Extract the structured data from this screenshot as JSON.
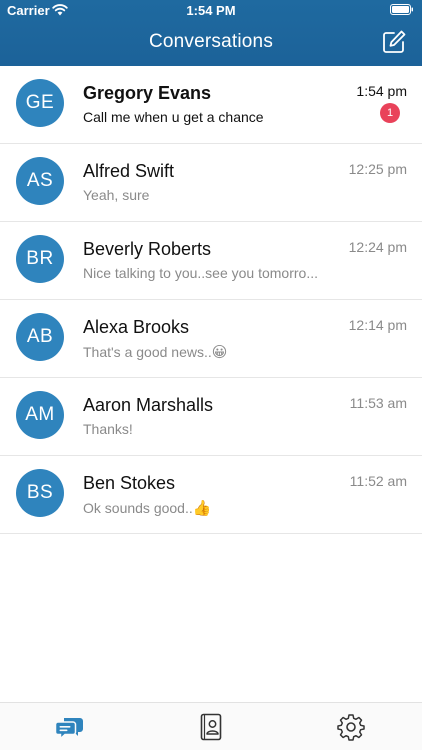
{
  "status": {
    "carrier": "Carrier",
    "time": "1:54 PM"
  },
  "nav": {
    "title": "Conversations"
  },
  "colors": {
    "header": "#1f6aa0",
    "avatar": "#2f84bd",
    "badge": "#e9425a",
    "active_tab": "#2f84bd"
  },
  "conversations": [
    {
      "initials": "GE",
      "name": "Gregory Evans",
      "preview": "Call me when u get a chance",
      "time": "1:54 pm",
      "unread": "1"
    },
    {
      "initials": "AS",
      "name": "Alfred Swift",
      "preview": "Yeah, sure",
      "time": "12:25 pm"
    },
    {
      "initials": "BR",
      "name": "Beverly Roberts",
      "preview": "Nice talking to you..see you tomorro...",
      "time": "12:24 pm"
    },
    {
      "initials": "AB",
      "name": "Alexa Brooks",
      "preview": "That's a good news..",
      "emoji": "😀",
      "time": "12:14 pm"
    },
    {
      "initials": "AM",
      "name": "Aaron Marshalls",
      "preview": "Thanks!",
      "time": "11:53 am"
    },
    {
      "initials": "BS",
      "name": "Ben Stokes",
      "preview": "Ok sounds good..",
      "emoji": "👍",
      "time": "11:52 am"
    }
  ],
  "tabs": [
    {
      "icon": "chat-bubbles-icon",
      "active": true
    },
    {
      "icon": "contacts-book-icon",
      "active": false
    },
    {
      "icon": "gear-icon",
      "active": false
    }
  ]
}
